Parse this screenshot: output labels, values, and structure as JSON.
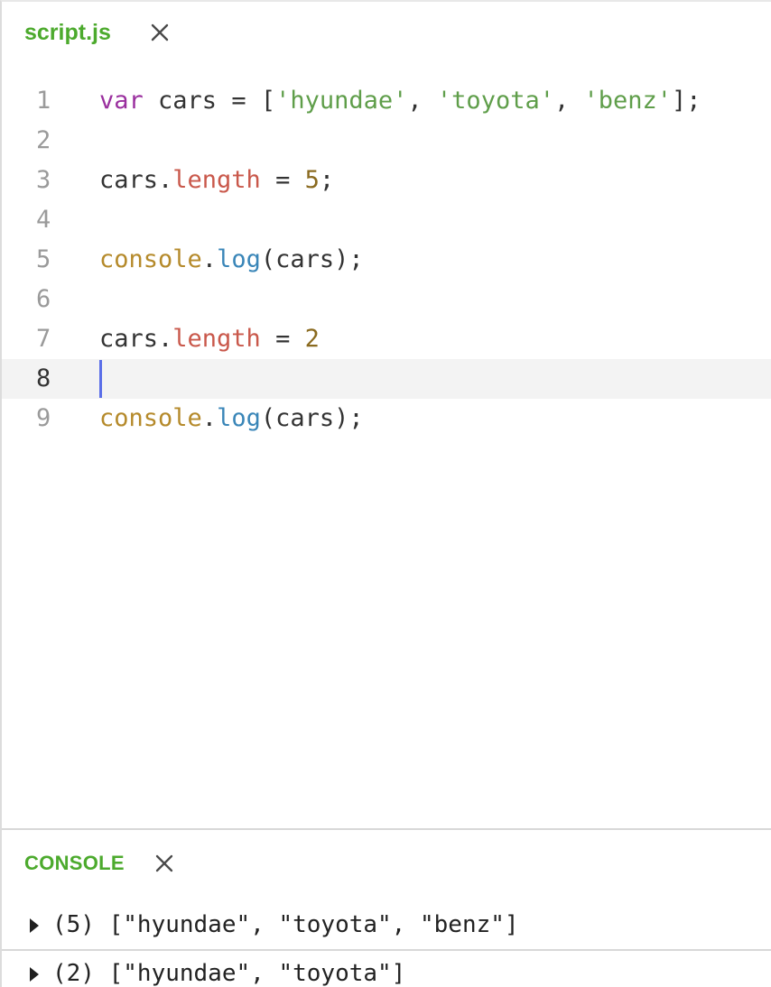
{
  "editor_tab": {
    "title": "script.js",
    "close_icon": "close-icon"
  },
  "code_lines": [
    {
      "number": "1",
      "tokens": [
        {
          "text": "var",
          "type": "keyword"
        },
        {
          "text": " cars = [",
          "type": "plain"
        },
        {
          "text": "'hyundae'",
          "type": "string"
        },
        {
          "text": ", ",
          "type": "plain"
        },
        {
          "text": "'toyota'",
          "type": "string"
        },
        {
          "text": ", ",
          "type": "plain"
        },
        {
          "text": "'benz'",
          "type": "string"
        },
        {
          "text": "];",
          "type": "plain"
        }
      ]
    },
    {
      "number": "2",
      "tokens": []
    },
    {
      "number": "3",
      "tokens": [
        {
          "text": "cars.",
          "type": "plain"
        },
        {
          "text": "length",
          "type": "prop"
        },
        {
          "text": " = ",
          "type": "plain"
        },
        {
          "text": "5",
          "type": "number"
        },
        {
          "text": ";",
          "type": "plain"
        }
      ]
    },
    {
      "number": "4",
      "tokens": []
    },
    {
      "number": "5",
      "tokens": [
        {
          "text": "console",
          "type": "builtin"
        },
        {
          "text": ".",
          "type": "plain"
        },
        {
          "text": "log",
          "type": "method"
        },
        {
          "text": "(cars);",
          "type": "plain"
        }
      ]
    },
    {
      "number": "6",
      "tokens": []
    },
    {
      "number": "7",
      "tokens": [
        {
          "text": "cars.",
          "type": "plain"
        },
        {
          "text": "length",
          "type": "prop"
        },
        {
          "text": " = ",
          "type": "plain"
        },
        {
          "text": "2",
          "type": "number"
        }
      ]
    },
    {
      "number": "8",
      "tokens": [],
      "active": true,
      "caret": true
    },
    {
      "number": "9",
      "tokens": [
        {
          "text": "console",
          "type": "builtin"
        },
        {
          "text": ".",
          "type": "plain"
        },
        {
          "text": "log",
          "type": "method"
        },
        {
          "text": "(cars);",
          "type": "plain"
        }
      ]
    }
  ],
  "console": {
    "title": "CONSOLE",
    "close_icon": "close-icon",
    "entries": [
      {
        "text": "(5) [\"hyundae\", \"toyota\", \"benz\"]",
        "icon": "expand-arrow-icon"
      },
      {
        "text": "(2) [\"hyundae\", \"toyota\"]",
        "icon": "expand-arrow-icon"
      }
    ]
  },
  "colors": {
    "accent_green": "#4caa2d",
    "keyword": "#9a2f9e",
    "string": "#5f9e4a",
    "property": "#c9584b",
    "number": "#8a6a1f",
    "builtin": "#b58a2b",
    "method": "#3a86b8",
    "caret": "#5a6ee8",
    "active_line_bg": "#f3f3f3"
  }
}
